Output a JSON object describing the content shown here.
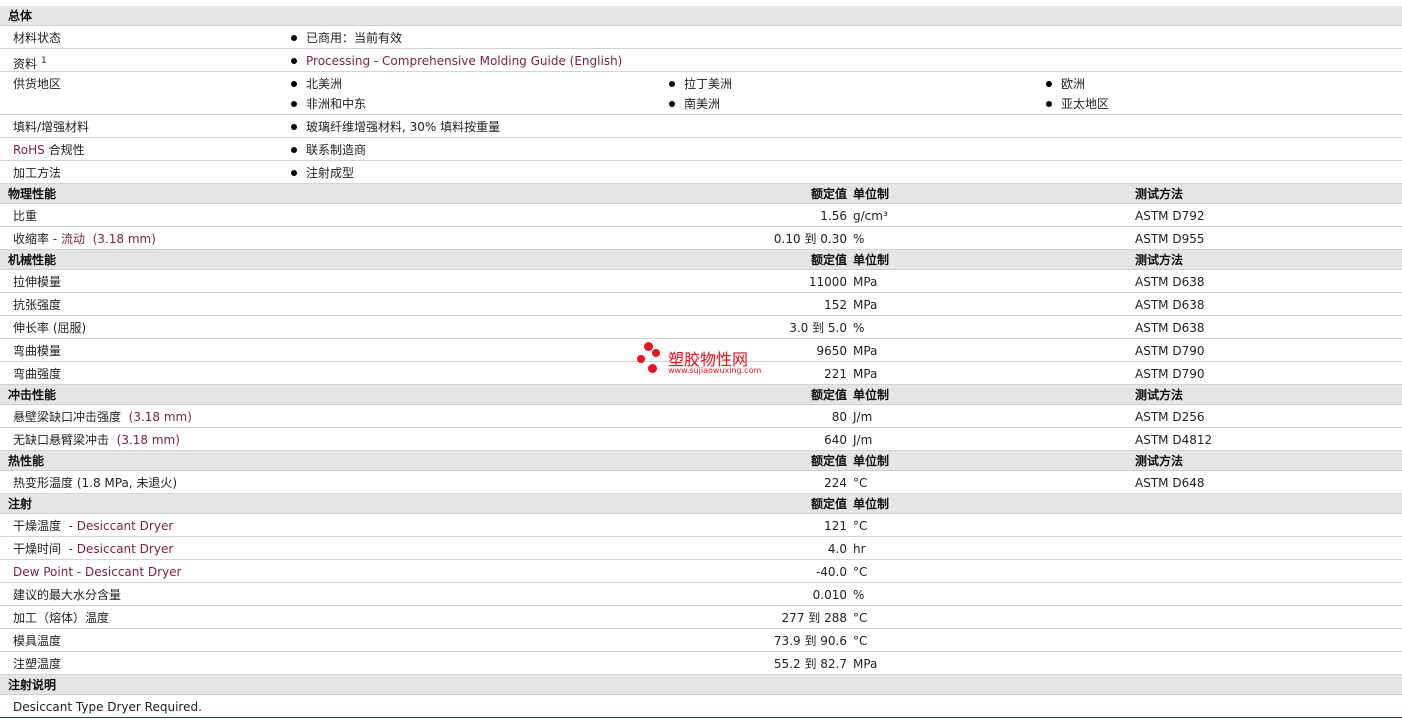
{
  "general": {
    "title": "总体",
    "rows": [
      {
        "label": "材料状态",
        "items": [
          "已商用：当前有效"
        ]
      },
      {
        "label": "资料",
        "label_sup": "1",
        "items": [
          "Processing - Comprehensive Molding Guide (English)"
        ]
      },
      {
        "label": "供货地区",
        "items": [
          "北美洲",
          "拉丁美洲",
          "欧洲",
          "非洲和中东",
          "南美洲",
          "亚太地区"
        ]
      },
      {
        "label": "填料/增强材料",
        "items": [
          "玻璃纤维增强材料, 30% 填料按重量"
        ]
      },
      {
        "label": "RoHS 合规性",
        "items": [
          "联系制造商"
        ]
      },
      {
        "label": "加工方法",
        "items": [
          "注射成型"
        ]
      }
    ]
  },
  "column_headers": {
    "value": "额定值",
    "unit": "单位制",
    "method": "测试方法"
  },
  "sections": [
    {
      "title": "物理性能",
      "rows": [
        {
          "label": "比重",
          "value": "1.56",
          "unit": "g/cm³",
          "method": "ASTM D792"
        },
        {
          "label": "收缩率",
          "label_note": " - 流动  (3.18 mm)",
          "value": "0.10 到  0.30",
          "unit": "%",
          "method": "ASTM D955"
        }
      ]
    },
    {
      "title": "机械性能",
      "rows": [
        {
          "label": "拉伸模量",
          "value": "11000",
          "unit": "MPa",
          "method": "ASTM D638"
        },
        {
          "label": "抗张强度",
          "value": "152",
          "unit": "MPa",
          "method": "ASTM D638"
        },
        {
          "label": "伸长率  (屈服)",
          "value": "3.0 到  5.0",
          "unit": "%",
          "method": "ASTM D638"
        },
        {
          "label": "弯曲模量",
          "value": "9650",
          "unit": "MPa",
          "method": "ASTM D790"
        },
        {
          "label": "弯曲强度",
          "value": "221",
          "unit": "MPa",
          "method": "ASTM D790"
        }
      ]
    },
    {
      "title": "冲击性能",
      "rows": [
        {
          "label": "悬壁梁缺口冲击强度",
          "label_note": "  (3.18 mm)",
          "value": "80",
          "unit": "J/m",
          "method": "ASTM D256"
        },
        {
          "label": "无缺口悬臂梁冲击",
          "label_note": "  (3.18 mm)",
          "value": "640",
          "unit": "J/m",
          "method": "ASTM D4812"
        }
      ]
    },
    {
      "title": "热性能",
      "rows": [
        {
          "label": "热变形温度  (1.8 MPa, 未退火)",
          "value": "224",
          "unit": "°C",
          "method": "ASTM D648"
        }
      ]
    },
    {
      "title": "注射",
      "hide_method": true,
      "rows": [
        {
          "label": "干燥温度",
          "label_note": "  - Desiccant Dryer",
          "value": "121",
          "unit": "°C",
          "method": ""
        },
        {
          "label": "干燥时间",
          "label_note": "  - Desiccant Dryer",
          "value": "4.0",
          "unit": "hr",
          "method": ""
        },
        {
          "label": "Dew Point - Desiccant Dryer",
          "label_link": true,
          "value": "-40.0",
          "unit": "°C",
          "method": ""
        },
        {
          "label": "建议的最大水分含量",
          "value": "0.010",
          "unit": "%",
          "method": ""
        },
        {
          "label": "加工（熔体）温度",
          "value": "277 到  288",
          "unit": "°C",
          "method": ""
        },
        {
          "label": "模具温度",
          "value": "73.9 到  90.6",
          "unit": "°C",
          "method": ""
        },
        {
          "label": "注塑温度",
          "value": "55.2 到  82.7",
          "unit": "MPa",
          "method": ""
        }
      ]
    }
  ],
  "notes": {
    "title": "注射说明",
    "text": "Desiccant Type Dryer Required."
  },
  "watermark": {
    "title": "塑胶物性网",
    "url": "www.sujiaowuxing.com",
    "color": "#e8141e"
  }
}
